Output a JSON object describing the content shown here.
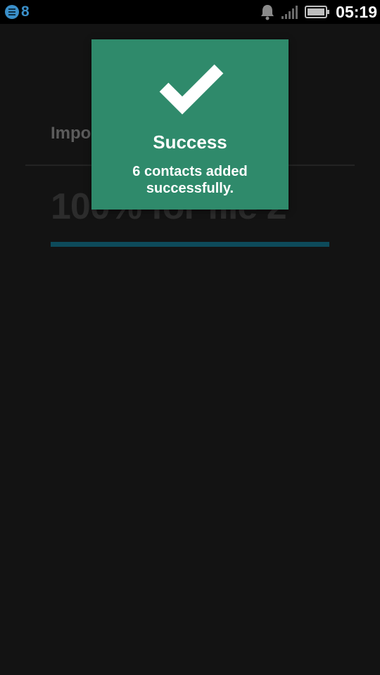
{
  "status_bar": {
    "notification_count": "8",
    "time": "05:19",
    "icons": [
      "notification-list-icon",
      "bell-icon",
      "signal-icon",
      "battery-icon"
    ],
    "accent_color": "#3a8fc9"
  },
  "import_screen": {
    "heading": "Impo",
    "progress_text": "100% for file 2",
    "progress_value": 1.0,
    "progress_color": "#0d4a5a"
  },
  "toast": {
    "icon": "checkmark-icon",
    "title": "Success",
    "message": "6 contacts added successfully.",
    "background_color": "#2f8a6b"
  }
}
